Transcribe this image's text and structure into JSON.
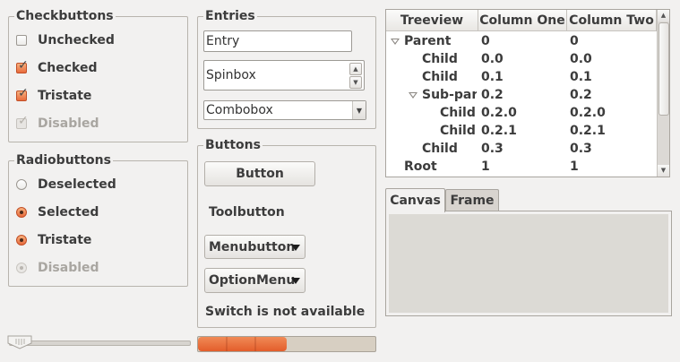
{
  "checkbuttons": {
    "title": "Checkbuttons",
    "items": [
      {
        "label": "Unchecked",
        "state": "unchecked"
      },
      {
        "label": "Checked",
        "state": "checked"
      },
      {
        "label": "Tristate",
        "state": "checked"
      },
      {
        "label": "Disabled",
        "state": "disabled-checked"
      }
    ]
  },
  "radiobuttons": {
    "title": "Radiobuttons",
    "items": [
      {
        "label": "Deselected",
        "state": "deselected"
      },
      {
        "label": "Selected",
        "state": "selected"
      },
      {
        "label": "Tristate",
        "state": "selected"
      },
      {
        "label": "Disabled",
        "state": "disabled"
      }
    ]
  },
  "entries": {
    "title": "Entries",
    "entry_value": "Entry",
    "spinbox_value": "Spinbox",
    "combobox_value": "Combobox"
  },
  "buttons": {
    "title": "Buttons",
    "button_label": "Button",
    "toolbutton_label": "Toolbutton",
    "menubutton_label": "Menubutton",
    "optionmenu_label": "OptionMenu",
    "switch_label": "Switch is not available"
  },
  "treeview": {
    "headers": [
      "Treeview",
      "Column One",
      "Column Two"
    ],
    "rows": [
      {
        "name": "Parent",
        "col1": "0",
        "col2": "0",
        "level": 0,
        "expanded": true
      },
      {
        "name": "Child",
        "col1": "0.0",
        "col2": "0.0",
        "level": 1,
        "expanded": false
      },
      {
        "name": "Child",
        "col1": "0.1",
        "col2": "0.1",
        "level": 1,
        "expanded": false
      },
      {
        "name": "Sub-pare",
        "col1": "0.2",
        "col2": "0.2",
        "level": 1,
        "expanded": true
      },
      {
        "name": "Child",
        "col1": "0.2.0",
        "col2": "0.2.0",
        "level": 2,
        "expanded": false
      },
      {
        "name": "Child",
        "col1": "0.2.1",
        "col2": "0.2.1",
        "level": 2,
        "expanded": false
      },
      {
        "name": "Child",
        "col1": "0.3",
        "col2": "0.3",
        "level": 1,
        "expanded": false
      },
      {
        "name": "Root",
        "col1": "1",
        "col2": "1",
        "level": 0,
        "expanded": false
      }
    ]
  },
  "notebook": {
    "tabs": [
      "Canvas",
      "Frame"
    ],
    "active_tab": "Canvas"
  },
  "scale": {
    "value": 0.0
  },
  "progress": {
    "value": 0.5
  },
  "colors": {
    "accent": "#e86a3c",
    "background": "#f2f1f0",
    "canvas": "#dcdad5"
  },
  "icons": {
    "check": "check-mark-icon",
    "spin_up": "triangle-up-icon",
    "spin_down": "triangle-down-icon",
    "dropdown": "triangle-down-icon",
    "expander": "expander-triangle-icon"
  }
}
